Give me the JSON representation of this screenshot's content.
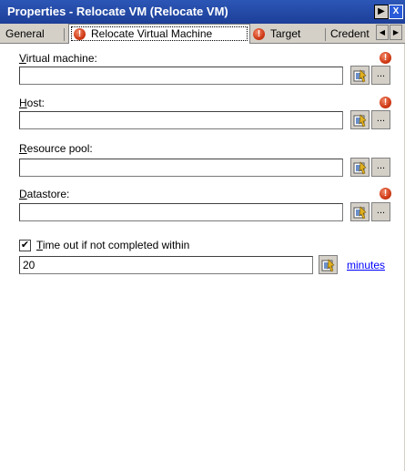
{
  "window": {
    "title": "Properties - Relocate VM (Relocate VM)",
    "help_label": "?",
    "close_label": "X"
  },
  "tabs": [
    {
      "label": "General"
    },
    {
      "label": "Relocate Virtual Machine",
      "error": true,
      "active": true
    },
    {
      "label": "Target",
      "error": true
    },
    {
      "label": "Credent"
    }
  ],
  "tab_scroll": {
    "left": "◀",
    "right": "▶"
  },
  "fields": [
    {
      "label": "Virtual machine:",
      "mnemonic": "V",
      "rest": "irtual machine:",
      "value": "",
      "required": true,
      "browse_label": "..."
    },
    {
      "label": "Host:",
      "mnemonic": "H",
      "rest": "ost:",
      "value": "",
      "required": true,
      "browse_label": "..."
    },
    {
      "label": "Resource pool:",
      "mnemonic": "R",
      "rest": "esource pool:",
      "value": "",
      "required": false,
      "browse_label": "..."
    },
    {
      "label": "Datastore:",
      "mnemonic": "D",
      "rest": "atastore:",
      "value": "",
      "required": true,
      "browse_label": "..."
    }
  ],
  "timeout": {
    "checked": true,
    "check_mark": "✔",
    "label_mnemonic": "T",
    "label_rest": "ime out if not completed within",
    "value": "20",
    "unit_link": "minutes"
  },
  "icons": {
    "error": "error-icon",
    "picker": "variable-picker-icon"
  },
  "colors": {
    "title_bar": "#1f43a0",
    "error_icon": "#d03a16",
    "link": "#0000ff"
  }
}
